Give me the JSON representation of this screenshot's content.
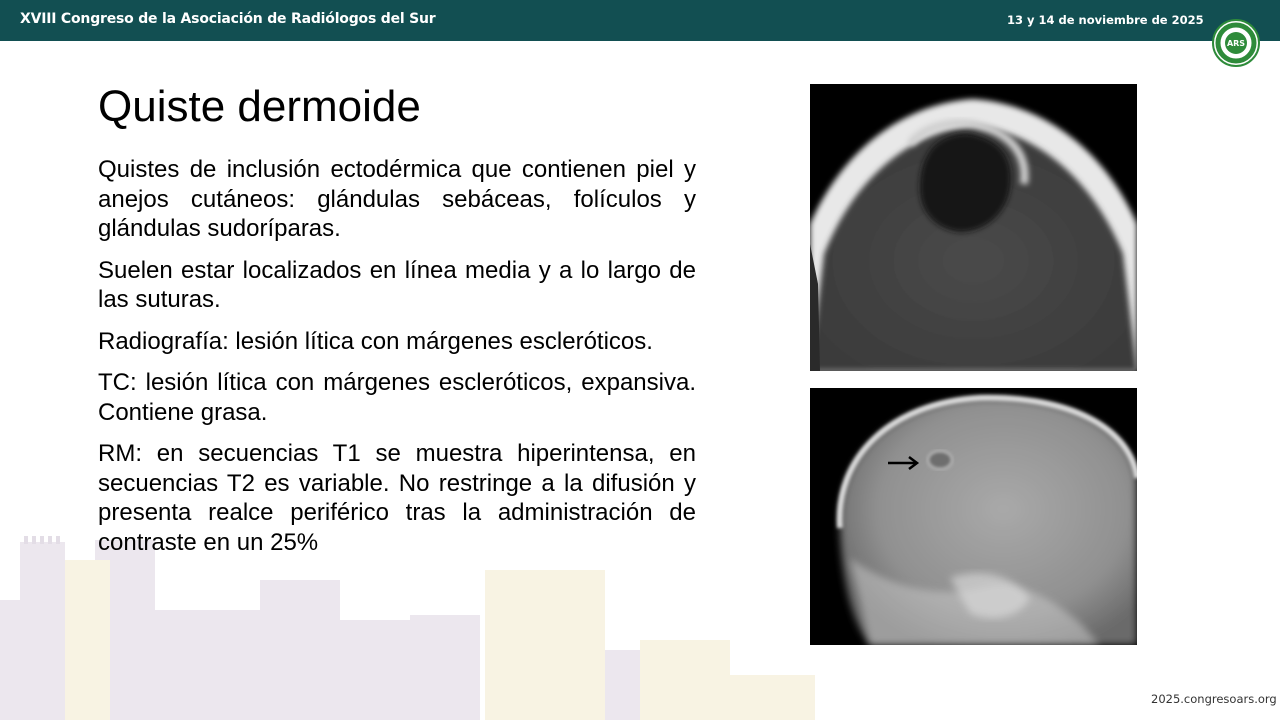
{
  "header": {
    "title": "XVIII Congreso de la Asociación de Radiólogos del Sur",
    "date": "13 y 14 de noviembre de 2025",
    "logo_text": "ARS",
    "background_color": "#124f52"
  },
  "slide": {
    "title": "Quiste dermoide",
    "paragraphs": [
      "Quistes de inclusión ectodérmica que contienen piel y anejos cutáneos: glándulas sebáceas, folículos y glándulas sudoríparas.",
      "Suelen estar localizados en línea media y a lo largo de las suturas.",
      "Radiografía: lesión lítica con márgenes escleróticos.",
      "TC: lesión lítica con márgenes escleróticos, expansiva. Contiene grasa.",
      "RM: en secuencias T1 se muestra hiperintensa, en secuencias T2 es variable. No restringe a la difusión y presenta realce periférico tras la administración de contraste en un 25%"
    ]
  },
  "footer": {
    "url": "2025.congresoars.org"
  }
}
